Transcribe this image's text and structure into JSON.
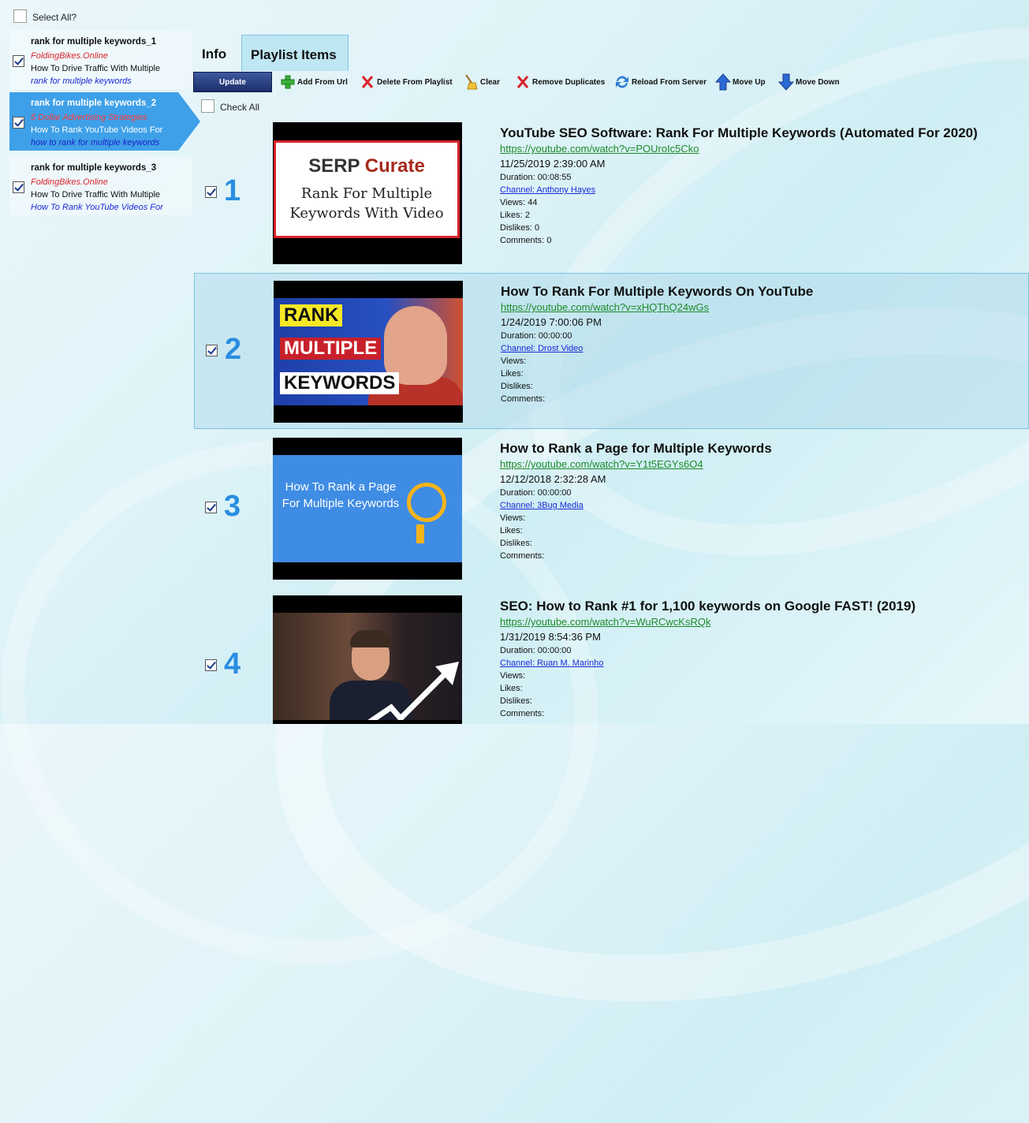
{
  "select_all": {
    "label": "Select All?",
    "checked": false
  },
  "playlists": [
    {
      "title": "rank for multiple keywords_1",
      "channel": "FoldingBikes.Online",
      "video": "How To Drive Traffic With Multiple",
      "keyword": "rank for multiple keywords",
      "checked": true,
      "selected": false
    },
    {
      "title": "rank for multiple keywords_2",
      "channel": "5 Dollar Advertising Strategies",
      "video": "How To Rank YouTube Videos For",
      "keyword": "how to rank for multiple keywords",
      "checked": true,
      "selected": true
    },
    {
      "title": "rank for multiple keywords_3",
      "channel": "FoldingBikes.Online",
      "video": "How To Drive Traffic With Multiple",
      "keyword": "How To Rank YouTube Videos For",
      "checked": true,
      "selected": false
    }
  ],
  "tabs": [
    {
      "label": "Info",
      "active": false
    },
    {
      "label": "Playlist Items",
      "active": true
    }
  ],
  "toolbar": {
    "update": "Update",
    "add_from_url": "Add From Url",
    "delete_from_playlist": "Delete From Playlist",
    "clear": "Clear",
    "remove_duplicates": "Remove Duplicates",
    "reload_from_server": "Reload From Server",
    "move_up": "Move Up",
    "move_down": "Move Down"
  },
  "check_all": {
    "label": "Check All",
    "checked": false
  },
  "labels": {
    "duration": "Duration:",
    "views": "Views:",
    "likes": "Likes:",
    "dislikes": "Dislikes:",
    "comments": "Comments:",
    "channel": "Channel:"
  },
  "items": [
    {
      "num": "1",
      "checked": true,
      "selected": false,
      "title": "YouTube SEO Software: Rank For Multiple Keywords (Automated For 2020)",
      "url": "https://youtube.com/watch?v=POUroIc5Cko",
      "date": "11/25/2019 2:39:00 AM",
      "duration": "00:08:55",
      "channel": "Anthony Hayes",
      "views": "44",
      "likes": "2",
      "dislikes": "0",
      "comments": "0",
      "thumb": {
        "serp": "SERP",
        "curate": "Curate",
        "line1": "Rank For Multiple",
        "line2": "Keywords With Video"
      }
    },
    {
      "num": "2",
      "checked": true,
      "selected": true,
      "title": "How To Rank For Multiple Keywords On YouTube",
      "url": "https://youtube.com/watch?v=xHQThQ24wGs",
      "date": "1/24/2019 7:00:06 PM",
      "duration": "00:00:00",
      "channel": "Drost Video",
      "views": "",
      "likes": "",
      "dislikes": "",
      "comments": "",
      "thumb": {
        "w1": "RANK",
        "w2": "MULTIPLE",
        "w3": "KEYWORDS"
      }
    },
    {
      "num": "3",
      "checked": true,
      "selected": false,
      "title": "How to Rank a Page for Multiple Keywords",
      "url": "https://youtube.com/watch?v=Y1t5EGYs6O4",
      "date": "12/12/2018 2:32:28 AM",
      "duration": "00:00:00",
      "channel": "3Bug Media",
      "views": "",
      "likes": "",
      "dislikes": "",
      "comments": "",
      "thumb": {
        "text": "How To Rank a Page For Multiple Keywords"
      }
    },
    {
      "num": "4",
      "checked": true,
      "selected": false,
      "title": "SEO: How to Rank #1 for 1,100 keywords on Google FAST! (2019)",
      "url": "https://youtube.com/watch?v=WuRCwcKsRQk",
      "date": "1/31/2019 8:54:36 PM",
      "duration": "00:00:00",
      "channel": "Ruan M. Marinho",
      "views": "",
      "likes": "",
      "dislikes": "",
      "comments": "",
      "thumb": {}
    }
  ],
  "colors": {
    "accent": "#3ea0e8",
    "number": "#2a8ee0",
    "url": "#1d8a2a",
    "channel_link": "#1a2ad6",
    "playlist_channel": "#d8232a"
  }
}
